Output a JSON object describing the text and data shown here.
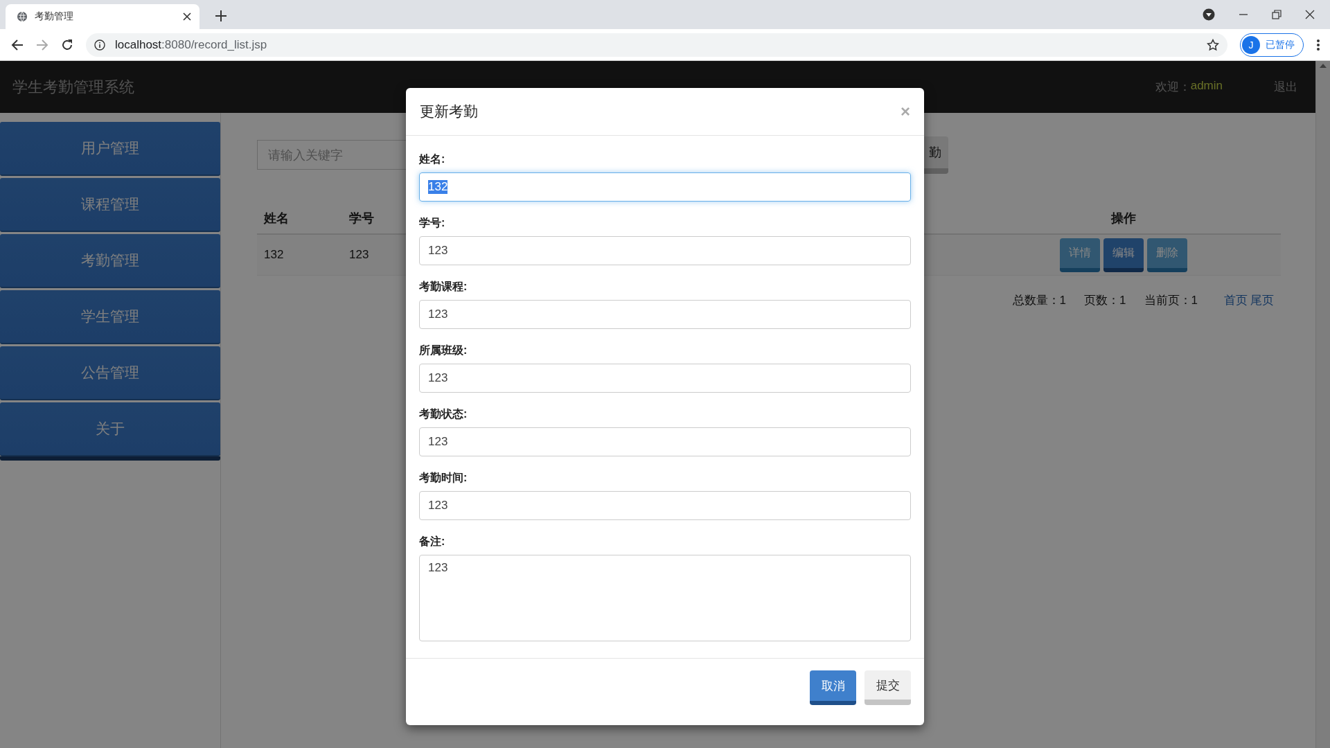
{
  "browser": {
    "tab_title": "考勤管理",
    "url_host": "localhost",
    "url_path": ":8080/record_list.jsp",
    "profile_initial": "J",
    "profile_status": "已暂停"
  },
  "navbar": {
    "brand": "学生考勤管理系统",
    "welcome": "欢迎：",
    "user": "admin",
    "logout": "退出"
  },
  "sidebar": {
    "items": [
      "用户管理",
      "课程管理",
      "考勤管理",
      "学生管理",
      "公告管理",
      "关于"
    ]
  },
  "search": {
    "placeholder": "请输入关键字",
    "button": "勤"
  },
  "table": {
    "columns": [
      "姓名",
      "学号",
      "操作"
    ],
    "rows": [
      {
        "cells": [
          "132",
          "123"
        ],
        "actions": [
          {
            "label": "详情",
            "kind": "info"
          },
          {
            "label": "编辑",
            "kind": "primary"
          },
          {
            "label": "删除",
            "kind": "info"
          }
        ]
      }
    ]
  },
  "pagination": {
    "stats": [
      "总数量：1",
      "页数：1",
      "当前页：1"
    ],
    "links": [
      "首页",
      "尾页"
    ]
  },
  "modal": {
    "title": "更新考勤",
    "close": "×",
    "fields": [
      {
        "label": "姓名:",
        "value": "132",
        "kind": "input",
        "focused": true
      },
      {
        "label": "学号:",
        "value": "123",
        "kind": "input",
        "focused": false
      },
      {
        "label": "考勤课程:",
        "value": "123",
        "kind": "input",
        "focused": false
      },
      {
        "label": "所属班级:",
        "value": "123",
        "kind": "input",
        "focused": false
      },
      {
        "label": "考勤状态:",
        "value": "123",
        "kind": "input",
        "focused": false
      },
      {
        "label": "考勤时间:",
        "value": "123",
        "kind": "input",
        "focused": false
      },
      {
        "label": "备注:",
        "value": "123",
        "kind": "textarea",
        "focused": false
      }
    ],
    "buttons": [
      {
        "label": "取消",
        "kind": "primary"
      },
      {
        "label": "提交",
        "kind": "default"
      }
    ]
  }
}
